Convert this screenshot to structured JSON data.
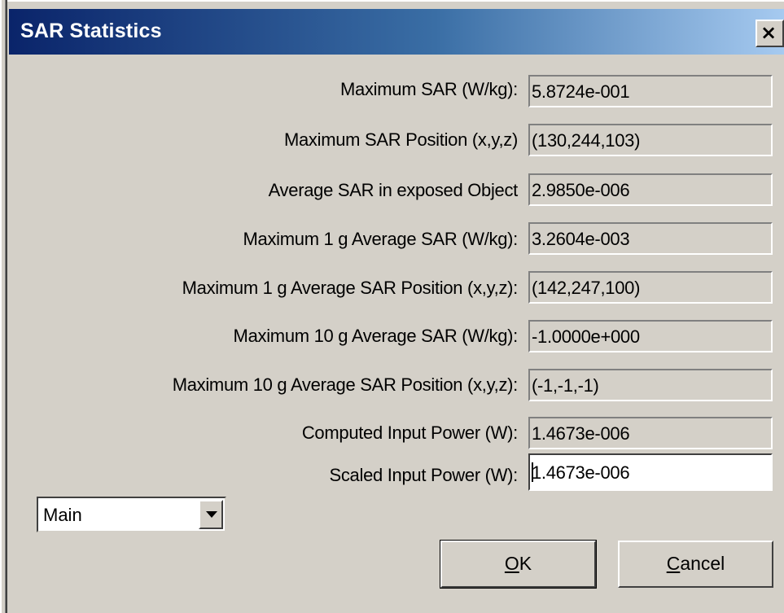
{
  "dialog": {
    "title": "SAR Statistics",
    "close_glyph": "×"
  },
  "rows": [
    {
      "label": "Maximum SAR (W/kg):",
      "value": "5.8724e-001"
    },
    {
      "label": "Maximum SAR Position (x,y,z)",
      "value": "(130,244,103)"
    },
    {
      "label": "Average SAR in exposed Object",
      "value": "2.9850e-006"
    },
    {
      "label": "Maximum 1 g  Average SAR (W/kg):",
      "value": "3.2604e-003"
    },
    {
      "label": "Maximum 1 g Average SAR Position (x,y,z):",
      "value": "(142,247,100)"
    },
    {
      "label": "Maximum 10 g Average SAR (W/kg):",
      "value": "-1.0000e+000"
    },
    {
      "label": "Maximum 10 g  Average SAR Position (x,y,z):",
      "value": "(-1,-1,-1)"
    },
    {
      "label": "Computed Input Power (W):",
      "value": "1.4673e-006"
    },
    {
      "label": "Scaled Input Power (W):",
      "value": "1.4673e-006"
    }
  ],
  "selector": {
    "value": "Main"
  },
  "buttons": {
    "ok": {
      "mnemonic": "O",
      "rest": "K"
    },
    "cancel": {
      "mnemonic": "C",
      "rest": "ancel"
    }
  }
}
